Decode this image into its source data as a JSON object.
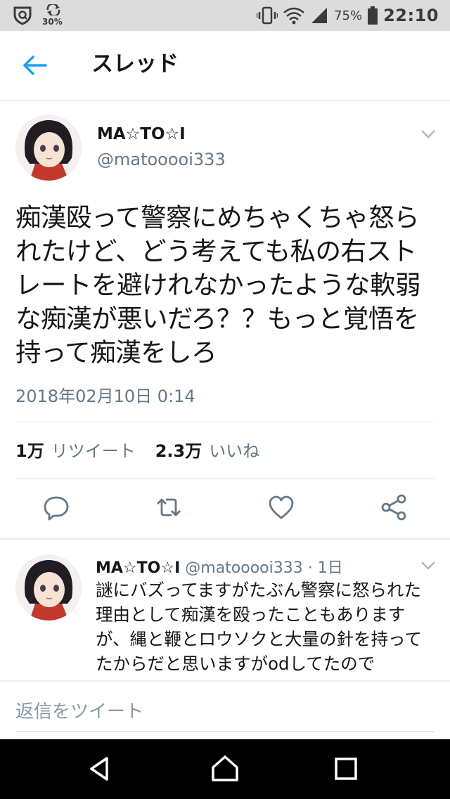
{
  "status_bar": {
    "data_percent": "30%",
    "battery_percent": "75%",
    "time": "22:10"
  },
  "app_bar": {
    "title": "スレッド",
    "icons": [
      "back-arrow-icon"
    ],
    "accent_color": "#1da1f2"
  },
  "main_tweet": {
    "author_name": "MA☆TO☆I",
    "author_handle": "@matooooi333",
    "text": "痴漢殴って警察にめちゃくちゃ怒られたけど、どう考えても私の右ストレートを避けれなかったような軟弱な痴漢が悪いだろ？？もっと覚悟を持って痴漢をしろ",
    "timestamp": "2018年02月10日 0:14",
    "retweet_count": "1万",
    "retweet_label": "リツイート",
    "like_count": "2.3万",
    "like_label": "いいね",
    "actions": [
      "reply-icon",
      "retweet-icon",
      "like-icon",
      "share-icon"
    ]
  },
  "reply_tweet": {
    "author_name": "MA☆TO☆I",
    "author_handle": "@matooooi333",
    "separator": " · ",
    "age": "1日",
    "text": "謎にバズってますがたぶん警察に怒られた理由として痴漢を殴ったこともありますが、縄と鞭とロウソクと大量の針を持ってたからだと思いますがodしてたので"
  },
  "compose": {
    "placeholder": "返信をツイート"
  },
  "nav_bar": {
    "buttons": [
      "back-triangle-icon",
      "home-circle-icon",
      "recents-square-icon"
    ]
  }
}
